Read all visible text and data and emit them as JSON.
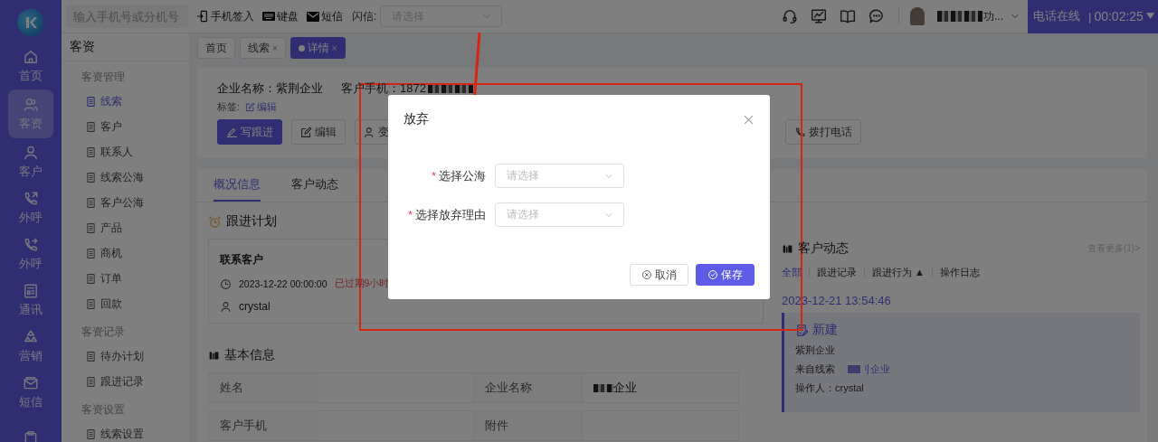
{
  "topbar": {
    "search": {
      "placeholder": "输入手机号或分机号"
    },
    "tools": [
      {
        "label": "手机签入"
      },
      {
        "label": "键盘"
      },
      {
        "label": "短信"
      }
    ],
    "flash": {
      "label": "闪信:",
      "placeholder": "请选择"
    },
    "user": {
      "name_tail": "功..."
    },
    "call_status": {
      "label": "电话在线",
      "separator": "|",
      "timer": "00:02:25"
    }
  },
  "nav": [
    {
      "label": "首页",
      "selected": false
    },
    {
      "label": "客资",
      "selected": true
    },
    {
      "label": "客户",
      "selected": false
    },
    {
      "label": "外呼",
      "selected": false
    },
    {
      "label": "外呼",
      "selected": false
    },
    {
      "label": "通讯",
      "selected": false
    },
    {
      "label": "营销",
      "selected": false
    },
    {
      "label": "短信",
      "selected": false
    },
    {
      "selected": false
    }
  ],
  "sidebar": {
    "title": "客资",
    "groups": [
      {
        "title": "客资管理",
        "items": [
          {
            "label": "线索",
            "selected": true
          },
          {
            "label": "客户",
            "selected": false
          },
          {
            "label": "联系人",
            "selected": false
          },
          {
            "label": "线索公海",
            "selected": false
          },
          {
            "label": "客户公海",
            "selected": false
          },
          {
            "label": "产品",
            "selected": false
          },
          {
            "label": "商机",
            "selected": false
          },
          {
            "label": "订单",
            "selected": false
          },
          {
            "label": "回款",
            "selected": false
          }
        ]
      },
      {
        "title": "客资记录",
        "items": [
          {
            "label": "待办计划",
            "selected": false
          },
          {
            "label": "跟进记录",
            "selected": false
          }
        ]
      },
      {
        "title": "客资设置",
        "items": [
          {
            "label": "线索设置",
            "selected": false
          }
        ]
      }
    ]
  },
  "page_tabs": [
    {
      "label": "首页",
      "selected": false
    },
    {
      "label": "线索",
      "close": "×",
      "selected": false
    },
    {
      "label": "详情",
      "close": "×",
      "selected": true
    }
  ],
  "header": {
    "company": "企业名称：紫荆企业",
    "phone": "客户手机：1872",
    "tags_label": "标签:",
    "tags_edit": "编辑",
    "buttons": [
      {
        "label": "写跟进",
        "primary": true
      },
      {
        "label": "编辑",
        "primary": false
      },
      {
        "label": "变",
        "primary": false
      }
    ],
    "right_buttons": [
      {
        "label": "拨打电话"
      }
    ]
  },
  "detail_tabs": [
    {
      "label": "概况信息",
      "selected": true
    },
    {
      "label": "客户动态",
      "selected": false
    }
  ],
  "plan": {
    "title": "跟进计划",
    "card": {
      "title": "联系客户",
      "time": "2023-12-22 00:00:00",
      "overdue": "已过期9小时",
      "owner": "crystal"
    }
  },
  "basic": {
    "title": "基本信息",
    "rows": [
      [
        {
          "label": "姓名"
        },
        {
          "label": "企业名称",
          "value_tail": "企业"
        }
      ],
      [
        {
          "label": "客户手机"
        },
        {
          "label": "附件"
        }
      ]
    ]
  },
  "activity": {
    "title": "客户动态",
    "more": "查看更多(1)>",
    "filters": [
      {
        "label": "全部",
        "selected": true
      },
      {
        "label": "跟进记录",
        "selected": false
      },
      {
        "label": "跟进行为 ▲",
        "selected": false
      },
      {
        "label": "操作日志",
        "selected": false
      }
    ],
    "date": "2023-12-21 13:54:46",
    "entry": {
      "title": "新建",
      "company": "紫荆企业",
      "source_label": "来自线索",
      "source_link": "刂企业",
      "operator": "操作人：crystal"
    }
  },
  "dialog": {
    "title": "放弃",
    "fields": [
      {
        "required_mark": "*",
        "label": "选择公海",
        "placeholder": "请选择"
      },
      {
        "required_mark": "*",
        "label": "选择放弃理由",
        "placeholder": "请选择"
      }
    ],
    "buttons": [
      {
        "label": "取消",
        "primary": false
      },
      {
        "label": "保存",
        "primary": true
      }
    ]
  }
}
